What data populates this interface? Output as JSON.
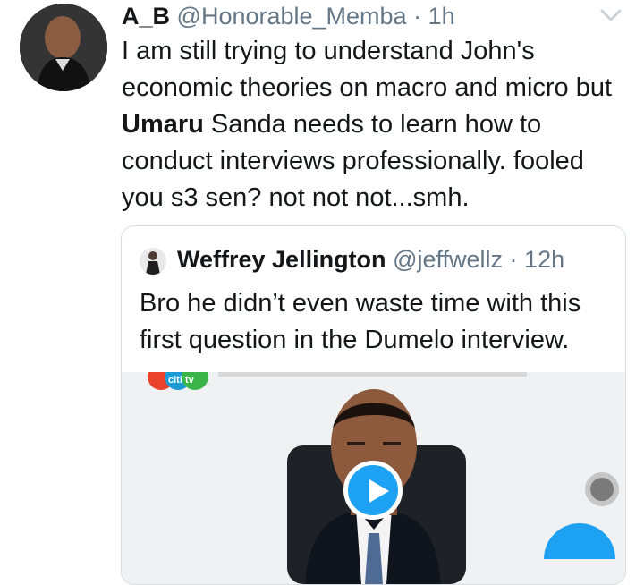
{
  "tweet": {
    "display_name": "A_B",
    "handle": "@Honorable_Memba",
    "separator": "·",
    "time": "1h",
    "text_parts": {
      "p1": "I am still trying to understand John's economic theories on macro and micro but ",
      "bold": "Umaru",
      "p2": " Sanda needs to learn how to conduct interviews professionally. fooled you s3 sen? not not not...smh."
    },
    "menu_icon": "chevron-down-icon"
  },
  "quoted_tweet": {
    "display_name": "Weffrey Jellington",
    "handle": "@jeffwellz",
    "separator": "·",
    "time": "12h",
    "text": "Bro he didn’t even waste time with this first question in the Dumelo interview.",
    "media": {
      "logo_text": "citi tv",
      "play_icon": "play-icon"
    }
  },
  "colors": {
    "primary_text": "#14171a",
    "secondary_text": "#657786",
    "accent": "#1da1f2",
    "border": "#d7dde2"
  }
}
